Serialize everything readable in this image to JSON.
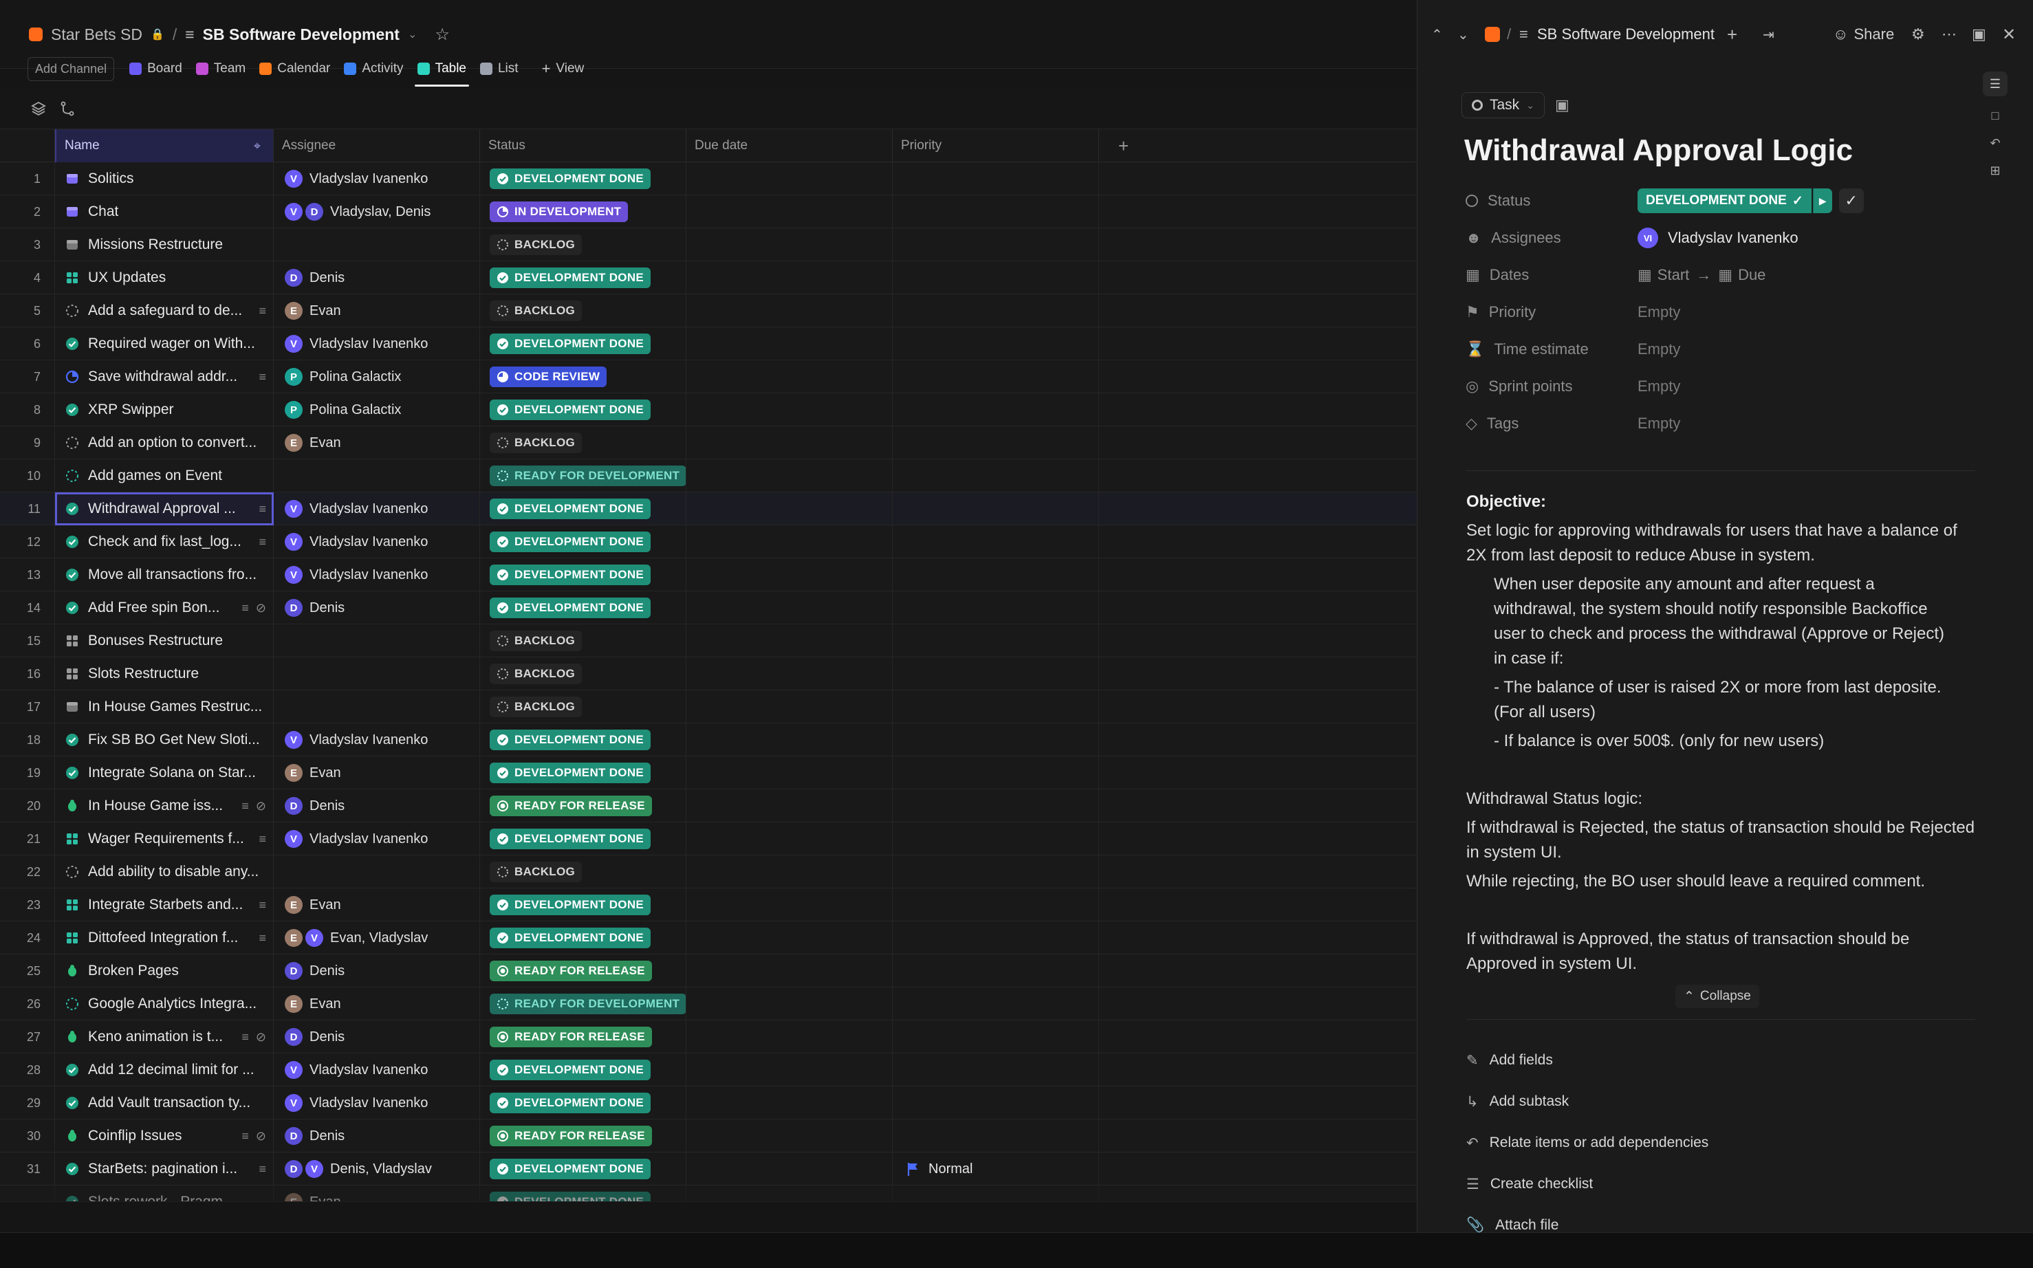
{
  "breadcrumb": {
    "workspace": "Star Bets SD",
    "separator": "/",
    "list": "SB Software Development"
  },
  "view_tabs": {
    "add_channel": "Add Channel",
    "tabs": [
      {
        "label": "Board",
        "color": "#6b5bf6"
      },
      {
        "label": "Team",
        "color": "#c24fd6"
      },
      {
        "label": "Calendar",
        "color": "#ff7a1a"
      },
      {
        "label": "Activity",
        "color": "#3b82f6"
      },
      {
        "label": "Table",
        "color": "#2dd4bf"
      },
      {
        "label": "List",
        "color": "#9ca3af"
      }
    ],
    "active": "Table",
    "add_view": "View"
  },
  "columns": [
    "Name",
    "Assignee",
    "Status",
    "Due date",
    "Priority"
  ],
  "statuses": {
    "dev_done": {
      "label": "DEVELOPMENT DONE",
      "color": "#1f8f78"
    },
    "in_dev": {
      "label": "IN DEVELOPMENT",
      "color": "#6b4fd6"
    },
    "backlog": {
      "label": "BACKLOG",
      "color": "#2a2a2a"
    },
    "code_review": {
      "label": "CODE REVIEW",
      "color": "#3b4fd6"
    },
    "ready_dev": {
      "label": "READY FOR DEVELOPMENT",
      "color": "#1f6b5e"
    },
    "ready_release": {
      "label": "READY FOR RELEASE",
      "color": "#2f8f5a"
    }
  },
  "rows": [
    {
      "num": "1",
      "name": "Solitics",
      "icon": "box",
      "assignee": "Vladyslav Ivanenko",
      "avatars": [
        "V"
      ],
      "status": "dev_done"
    },
    {
      "num": "2",
      "name": "Chat",
      "icon": "box",
      "assignee": "Vladyslav, Denis",
      "avatars": [
        "V",
        "D"
      ],
      "status": "in_dev"
    },
    {
      "num": "3",
      "name": "Missions Restructure",
      "icon": "box-gray",
      "assignee": "",
      "avatars": [],
      "status": "backlog"
    },
    {
      "num": "4",
      "name": "UX Updates",
      "icon": "grid",
      "assignee": "Denis",
      "avatars": [
        "D"
      ],
      "status": "dev_done"
    },
    {
      "num": "5",
      "name": "Add a safeguard to de...",
      "icon": "dashed",
      "assignee": "Evan",
      "avatars": [
        "E"
      ],
      "status": "backlog",
      "extra": [
        "lines"
      ]
    },
    {
      "num": "6",
      "name": "Required wager on With...",
      "icon": "check",
      "assignee": "Vladyslav Ivanenko",
      "avatars": [
        "V"
      ],
      "status": "dev_done"
    },
    {
      "num": "7",
      "name": "Save withdrawal addr...",
      "icon": "progress",
      "assignee": "Polina Galactix",
      "avatars": [
        "P"
      ],
      "status": "code_review",
      "extra": [
        "lines"
      ]
    },
    {
      "num": "8",
      "name": "XRP Swipper",
      "icon": "check",
      "assignee": "Polina Galactix",
      "avatars": [
        "P"
      ],
      "status": "dev_done"
    },
    {
      "num": "9",
      "name": "Add an option to convert...",
      "icon": "dashed",
      "assignee": "Evan",
      "avatars": [
        "E"
      ],
      "status": "backlog"
    },
    {
      "num": "10",
      "name": "Add games on Event",
      "icon": "dashed-teal",
      "assignee": "",
      "avatars": [],
      "status": "ready_dev"
    },
    {
      "num": "11",
      "name": "Withdrawal Approval ...",
      "icon": "check",
      "assignee": "Vladyslav Ivanenko",
      "avatars": [
        "V"
      ],
      "status": "dev_done",
      "extra": [
        "lines"
      ],
      "selected": true
    },
    {
      "num": "12",
      "name": "Check and fix last_log...",
      "icon": "check",
      "assignee": "Vladyslav Ivanenko",
      "avatars": [
        "V"
      ],
      "status": "dev_done",
      "extra": [
        "lines"
      ]
    },
    {
      "num": "13",
      "name": "Move all transactions fro...",
      "icon": "check",
      "assignee": "Vladyslav Ivanenko",
      "avatars": [
        "V"
      ],
      "status": "dev_done"
    },
    {
      "num": "14",
      "name": "Add Free spin Bon...",
      "icon": "check",
      "assignee": "Denis",
      "avatars": [
        "D"
      ],
      "status": "dev_done",
      "extra": [
        "lines",
        "clip"
      ]
    },
    {
      "num": "15",
      "name": "Bonuses Restructure",
      "icon": "grid-gray",
      "assignee": "",
      "avatars": [],
      "status": "backlog"
    },
    {
      "num": "16",
      "name": "Slots Restructure",
      "icon": "grid-gray",
      "assignee": "",
      "avatars": [],
      "status": "backlog"
    },
    {
      "num": "17",
      "name": "In House Games Restruc...",
      "icon": "box-gray",
      "assignee": "",
      "avatars": [],
      "status": "backlog"
    },
    {
      "num": "18",
      "name": "Fix SB BO Get New Sloti...",
      "icon": "check",
      "assignee": "Vladyslav Ivanenko",
      "avatars": [
        "V"
      ],
      "status": "dev_done"
    },
    {
      "num": "19",
      "name": "Integrate Solana on Star...",
      "icon": "check",
      "assignee": "Evan",
      "avatars": [
        "E"
      ],
      "status": "dev_done"
    },
    {
      "num": "20",
      "name": "In House Game iss...",
      "icon": "bug",
      "assignee": "Denis",
      "avatars": [
        "D"
      ],
      "status": "ready_release",
      "extra": [
        "lines",
        "clip"
      ]
    },
    {
      "num": "21",
      "name": "Wager Requirements f...",
      "icon": "grid",
      "assignee": "Vladyslav Ivanenko",
      "avatars": [
        "V"
      ],
      "status": "dev_done",
      "extra": [
        "lines"
      ]
    },
    {
      "num": "22",
      "name": "Add ability to disable any...",
      "icon": "dashed",
      "assignee": "",
      "avatars": [],
      "status": "backlog"
    },
    {
      "num": "23",
      "name": "Integrate Starbets and...",
      "icon": "grid",
      "assignee": "Evan",
      "avatars": [
        "E"
      ],
      "status": "dev_done",
      "extra": [
        "lines"
      ]
    },
    {
      "num": "24",
      "name": "Dittofeed Integration f...",
      "icon": "grid",
      "assignee": "Evan, Vladyslav",
      "avatars": [
        "E",
        "V"
      ],
      "status": "dev_done",
      "extra": [
        "lines"
      ]
    },
    {
      "num": "25",
      "name": "Broken Pages",
      "icon": "bug",
      "assignee": "Denis",
      "avatars": [
        "D"
      ],
      "status": "ready_release"
    },
    {
      "num": "26",
      "name": "Google Analytics Integra...",
      "icon": "dashed-teal",
      "assignee": "Evan",
      "avatars": [
        "E"
      ],
      "status": "ready_dev"
    },
    {
      "num": "27",
      "name": "Keno animation is t...",
      "icon": "bug",
      "assignee": "Denis",
      "avatars": [
        "D"
      ],
      "status": "ready_release",
      "extra": [
        "lines",
        "clip"
      ]
    },
    {
      "num": "28",
      "name": "Add 12 decimal limit for ...",
      "icon": "check",
      "assignee": "Vladyslav Ivanenko",
      "avatars": [
        "V"
      ],
      "status": "dev_done"
    },
    {
      "num": "29",
      "name": "Add Vault transaction ty...",
      "icon": "check",
      "assignee": "Vladyslav Ivanenko",
      "avatars": [
        "V"
      ],
      "status": "dev_done"
    },
    {
      "num": "30",
      "name": "Coinflip Issues",
      "icon": "bug",
      "assignee": "Denis",
      "avatars": [
        "D"
      ],
      "status": "ready_release",
      "extra": [
        "lines",
        "clip"
      ]
    },
    {
      "num": "31",
      "name": "StarBets: pagination i...",
      "icon": "check",
      "assignee": "Denis, Vladyslav",
      "avatars": [
        "D",
        "V"
      ],
      "status": "dev_done",
      "extra": [
        "lines"
      ],
      "priority": "Normal"
    },
    {
      "num": "",
      "name": "Slots rework - Pragm...",
      "icon": "check",
      "assignee": "Evan",
      "avatars": [
        "E"
      ],
      "status": "dev_done",
      "partial": true
    }
  ],
  "avatar_colors": {
    "V": "#6b5bf6",
    "D": "#5a4fd6",
    "E": "#9a7a68",
    "P": "#1aa396"
  },
  "panel": {
    "breadcrumb": "SB Software Development",
    "share": "Share",
    "task_type": "Task",
    "title": "Withdrawal Approval Logic",
    "fields": {
      "status_label": "Status",
      "status_value": "DEVELOPMENT DONE",
      "assignees_label": "Assignees",
      "assignee_initials": "VI",
      "assignee_name": "Vladyslav Ivanenko",
      "dates_label": "Dates",
      "start": "Start",
      "due": "Due",
      "priority_label": "Priority",
      "time_label": "Time estimate",
      "sprint_label": "Sprint points",
      "tags_label": "Tags",
      "empty": "Empty"
    },
    "description": {
      "objective_heading": "Objective:",
      "objective_text": "Set logic for approving withdrawals for users that have a balance of 2X from last deposit to reduce Abuse in system.",
      "indent_text": "When user deposite any amount and after request a withdrawal, the system should notify responsible Backoffice user to check and process the withdrawal (Approve or Reject) in case if:",
      "bullet1": "- The balance of user is raised 2X or more from last deposite. (For all users)",
      "bullet2": "- If balance is over 500$. (only for new users)",
      "status_heading": "Withdrawal Status logic:",
      "rejected_text": "If withdrawal is Rejected, the status of transaction should be Rejected in system UI.",
      "rejecting_text": "While rejecting, the BO user should leave a required comment.",
      "approved_text": "If withdrawal is Approved, the status of transaction should be Approved in system UI.",
      "collapse": "Collapse"
    },
    "actions": {
      "add_fields": "Add fields",
      "add_subtask": "Add subtask",
      "relate": "Relate items or add dependencies",
      "checklist": "Create checklist",
      "attach": "Attach file"
    }
  }
}
